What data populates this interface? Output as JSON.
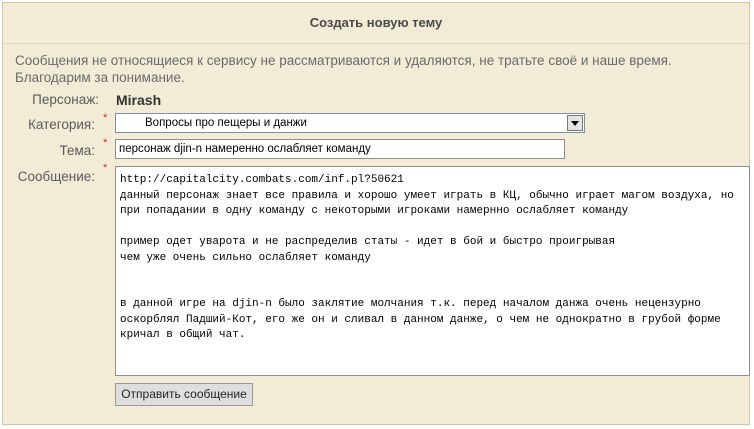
{
  "form": {
    "title": "Создать новую тему",
    "notice_line1": "Сообщения не относящиеся к сервису не рассматриваются и удаляются, не тратьте своё и наше время.",
    "notice_line2": "Благодарим за понимание.",
    "required_mark": "*",
    "character": {
      "label": "Персонаж:",
      "value": "Mirash"
    },
    "category": {
      "label": "Категория:",
      "selected": "Вопросы про пещеры и данжи"
    },
    "subject": {
      "label": "Тема:",
      "value": "персонаж djin-n намеренно ослабляет команду"
    },
    "message": {
      "label": "Сообщение:",
      "value": "http://capitalcity.combats.com/inf.pl?50621\nданный персонаж знает все правила и хорошо умеет играть в КЦ, обычно играет магом воздуха, но при попадании в одну команду с некоторыми игроками намернно ослабляет команду\n\nпример одет уварота и не распределив статы - идет в бой и быстро проигрывая\nчем уже очень сильно ослабляет команду\n\n\nв данной игре на djin-n было заклятие молчания т.к. перед началом данжа очень нецензурно оскорблял Падший-Кот, его же он и сливал в данном данже, о чем не однократно в грубой форме кричал в общий чат."
    },
    "submit_label": "Отправить сообщение"
  },
  "colors": {
    "panel_bg": "#f2ecd6",
    "required": "#d03030",
    "label": "#5a5a5a"
  }
}
